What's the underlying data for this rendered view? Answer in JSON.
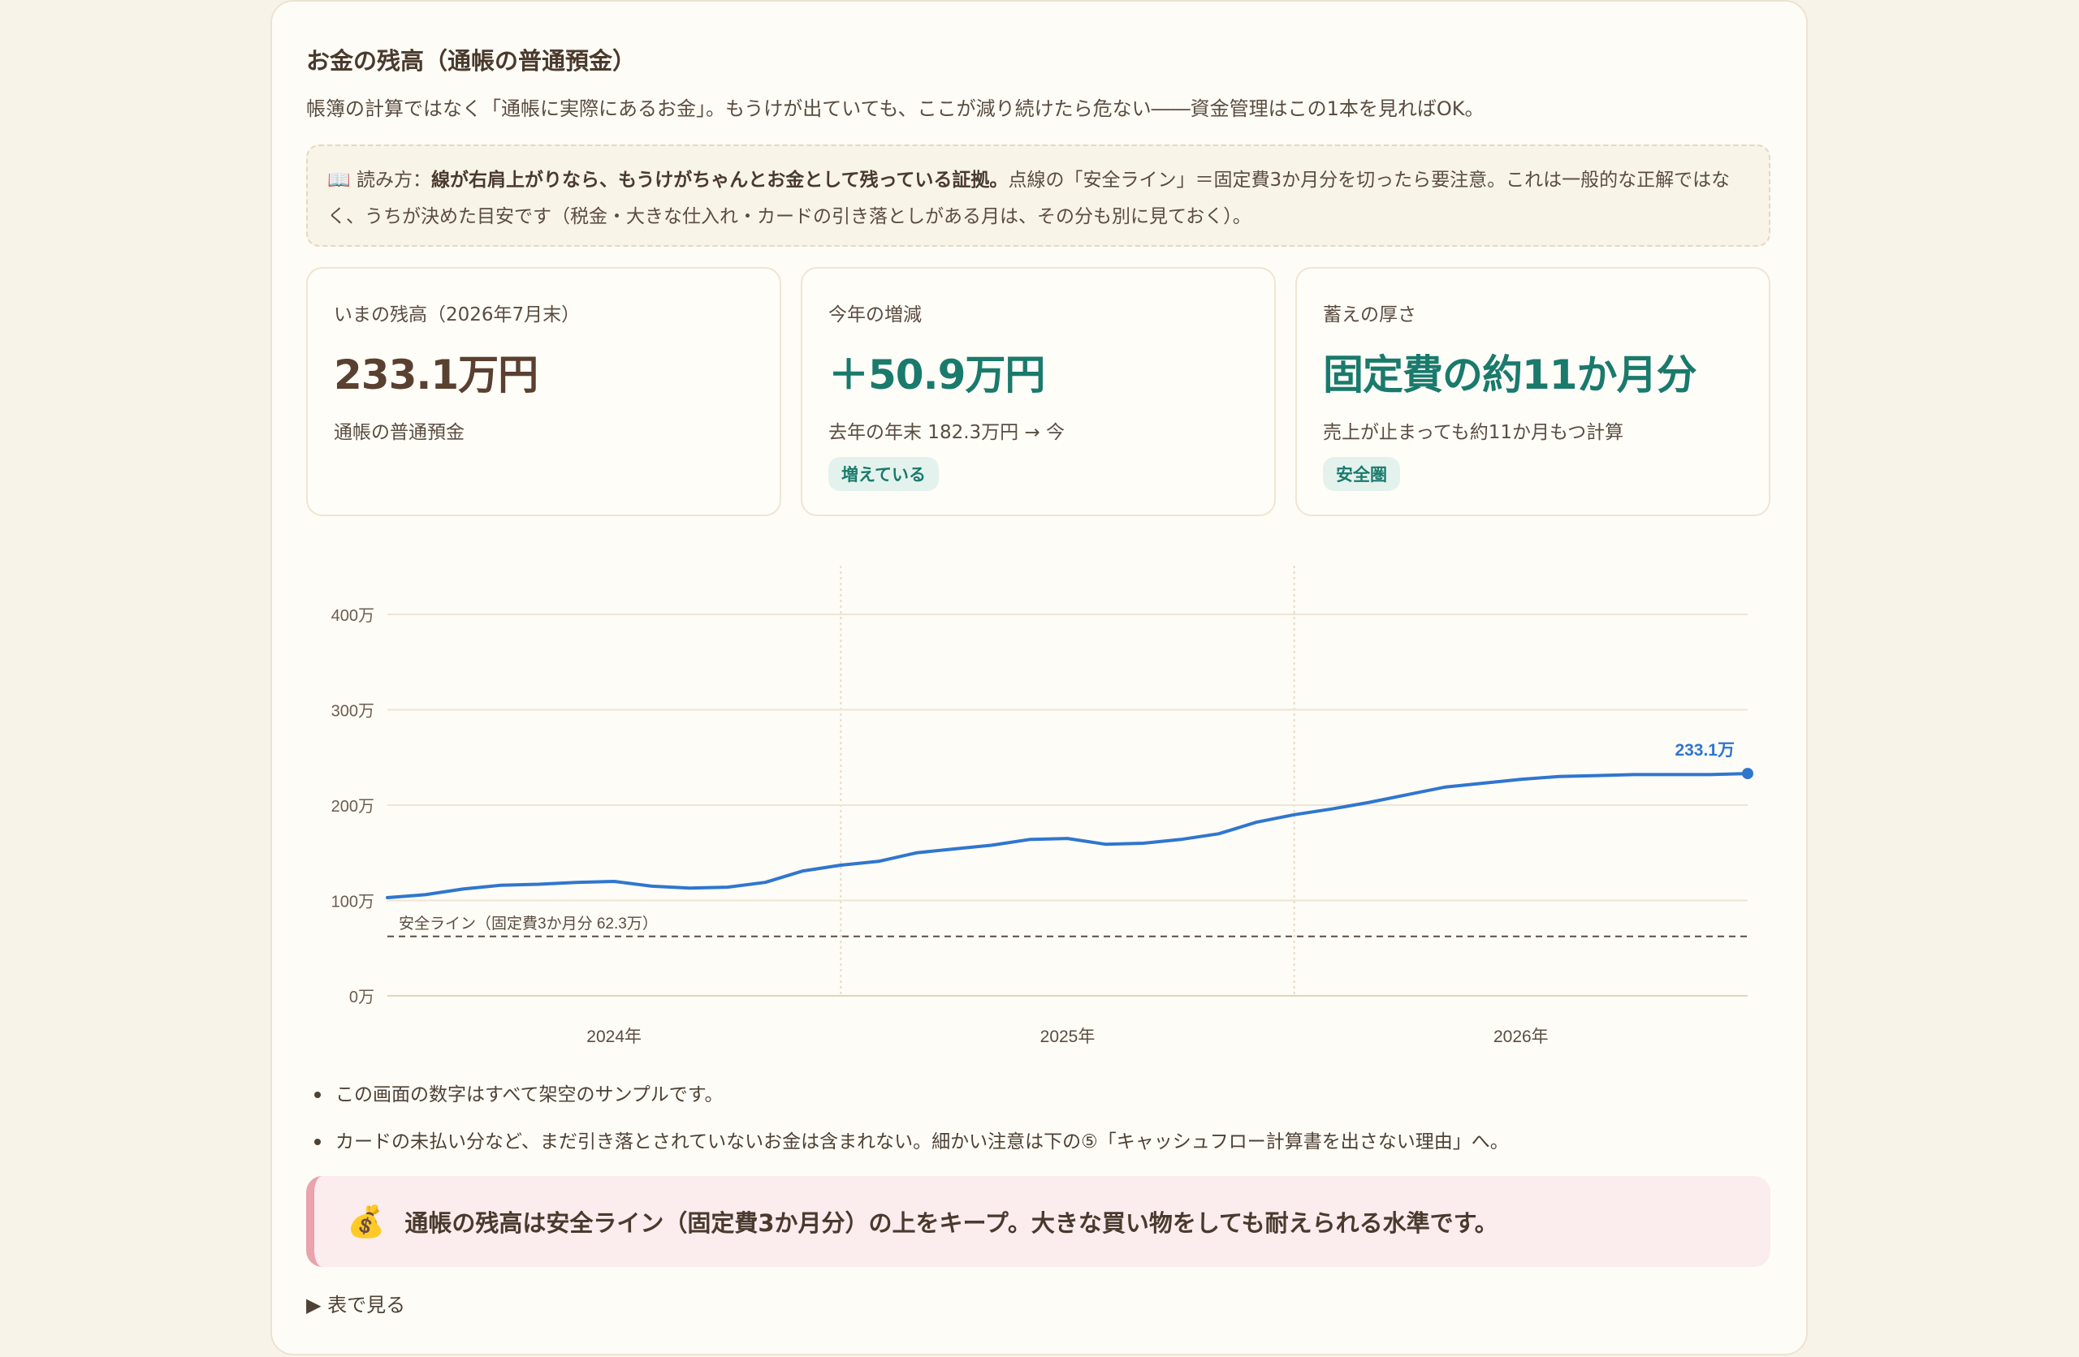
{
  "title": "お金の残高（通帳の普通預金）",
  "subtitle": "帳簿の計算ではなく「通帳に実際にあるお金」。もうけが出ていても、ここが減り続けたら危ない――資金管理はこの1本を見ればOK。",
  "howto": {
    "icon": "book-icon",
    "prefix": "📖 読み方：",
    "bold": "線が右肩上がりなら、もうけがちゃんとお金として残っている証拠。",
    "rest": "点線の「安全ライン」＝固定費3か月分を切ったら要注意。これは一般的な正解ではなく、うちが決めた目安です（税金・大きな仕入れ・カードの引き落としがある月は、その分も別に見ておく）。"
  },
  "kpis": [
    {
      "label": "いまの残高（2026年7月末）",
      "value": "233.1万円",
      "note": "通帳の普通預金",
      "badge": "",
      "color": "#5a4030"
    },
    {
      "label": "今年の増減",
      "value": "＋50.9万円",
      "note": "去年の年末 182.3万円 → 今",
      "badge": "増えている",
      "color": "#1a7a6c"
    },
    {
      "label": "蓄えの厚さ",
      "value": "固定費の約11か月分",
      "note": "売上が止まっても約11か月もつ計算",
      "badge": "安全圏",
      "color": "#1a7a6c"
    }
  ],
  "chart_data": {
    "type": "line",
    "title": "",
    "ylim": [
      0,
      4000000
    ],
    "y_ticks": [
      {
        "value": 0,
        "label": "0万"
      },
      {
        "value": 1000000,
        "label": "100万"
      },
      {
        "value": 2000000,
        "label": "200万"
      },
      {
        "value": 3000000,
        "label": "300万"
      },
      {
        "value": 4000000,
        "label": "400万"
      }
    ],
    "x": [
      "2023-07",
      "2023-08",
      "2023-09",
      "2023-10",
      "2023-11",
      "2023-12",
      "2024-01",
      "2024-02",
      "2024-03",
      "2024-04",
      "2024-05",
      "2024-06",
      "2024-07",
      "2024-08",
      "2024-09",
      "2024-10",
      "2024-11",
      "2024-12",
      "2025-01",
      "2025-02",
      "2025-03",
      "2025-04",
      "2025-05",
      "2025-06",
      "2025-07",
      "2025-08",
      "2025-09",
      "2025-10",
      "2025-11",
      "2025-12",
      "2026-01",
      "2026-02",
      "2026-03",
      "2026-04",
      "2026-05",
      "2026-06",
      "2026-07"
    ],
    "x_ticks": [
      {
        "x": "2024-01",
        "label": "2024年"
      },
      {
        "x": "2025-01",
        "label": "2025年"
      },
      {
        "x": "2026-01",
        "label": "2026年"
      }
    ],
    "vertical_gridlines": [
      "2024-07",
      "2025-07"
    ],
    "series": [
      {
        "color": "#2f76cf",
        "values": [
          1030000,
          1060000,
          1120000,
          1160000,
          1170000,
          1190000,
          1200000,
          1150000,
          1130000,
          1140000,
          1190000,
          1310000,
          1370000,
          1410000,
          1500000,
          1540000,
          1580000,
          1640000,
          1650000,
          1590000,
          1600000,
          1640000,
          1700000,
          1820000,
          1900000,
          1960000,
          2030000,
          2110000,
          2190000,
          2230000,
          2270000,
          2300000,
          2310000,
          2320000,
          2320000,
          2320000,
          2331000
        ]
      }
    ],
    "end_label": "233.1万",
    "safety_line": {
      "value": 623000,
      "label": "安全ライン（固定費3か月分 62.3万）",
      "color": "#5a4c41"
    },
    "grid": true
  },
  "notes": [
    "この画面の数字はすべて架空のサンプルです。",
    "カードの未払い分など、まだ引き落とされていないお金は含まれない。細かい注意は下の⑤「キャッシュフロー計算書を出さない理由」へ。"
  ],
  "callout": {
    "icon": "money-bag-icon",
    "emoji": "💰",
    "text": "通帳の残高は安全ライン（固定費3か月分）の上をキープ。大きな買い物をしても耐えられる水準です。"
  },
  "table_toggle": "▶ 表で見る"
}
